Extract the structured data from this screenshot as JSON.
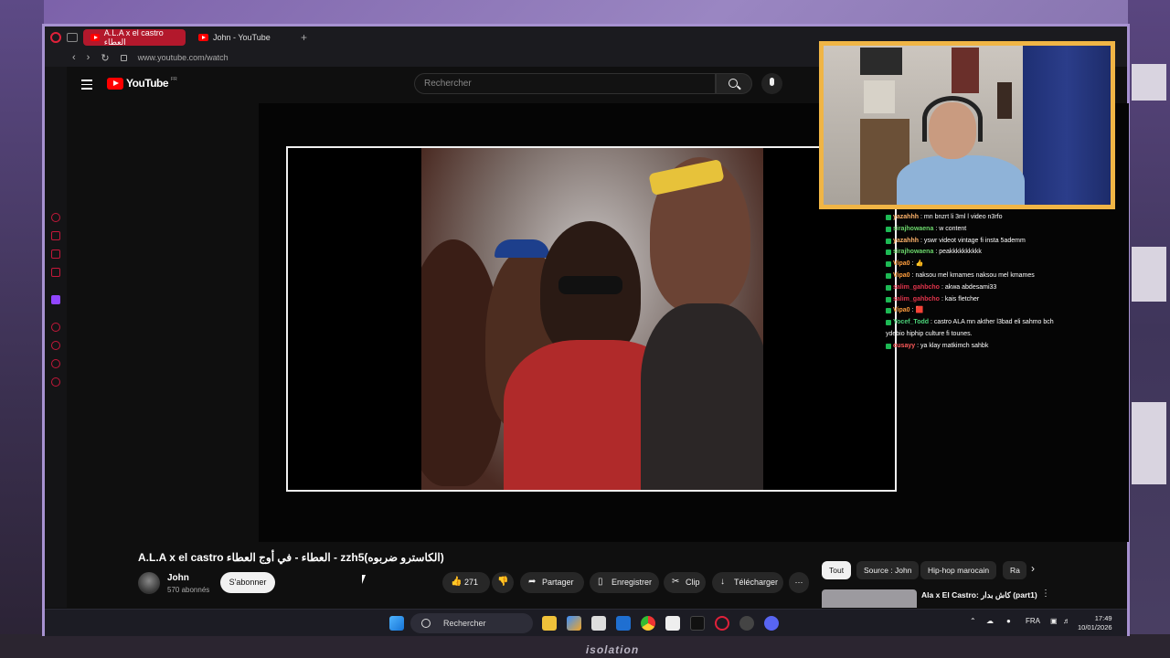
{
  "browser": {
    "tabs": [
      {
        "label": "A.L.A x el castro العطاء",
        "active": true
      },
      {
        "label": "John - YouTube",
        "active": false
      }
    ],
    "new_tab": "+",
    "url": "www.youtube.com/watch"
  },
  "youtube": {
    "logo": "YouTube",
    "logo_region": "FR",
    "search_placeholder": "Rechercher",
    "video_title": "A.L.A x el castro العطاء - في أوج العطاء - zzh5(الكاسترو ضربوه)",
    "channel": {
      "name": "John",
      "subscribers": "570 abonnés",
      "subscribe_label": "S'abonner"
    },
    "actions": {
      "likes": "271",
      "share": "Partager",
      "save": "Enregistrer",
      "clip": "Clip",
      "download": "Télécharger"
    },
    "chips": [
      "Tout",
      "Source : John",
      "Hip-hop marocain",
      "Ra"
    ],
    "next_video_title": "Ala x El Castro: كاش بدار (part1)"
  },
  "chat": [
    {
      "user": "yazahhh",
      "msg": ": mn bnzrt li 3ml l video n3rfo",
      "color": "#ffb36b"
    },
    {
      "user": "sirajhowaena",
      "msg": ": w content",
      "color": "#6bd66b"
    },
    {
      "user": "yazahhh",
      "msg": ": yswr videot vintage fi insta 5ademm",
      "color": "#ffb36b"
    },
    {
      "user": "sirajhowaena",
      "msg": ": peakkkkkkkkkk",
      "color": "#6bd66b"
    },
    {
      "user": "Vipa0",
      "msg": ": 👍",
      "color": "#ff9d3d"
    },
    {
      "user": "Vipa0",
      "msg": ": naksou mel kmames naksou mel kmames",
      "color": "#ff9d3d"
    },
    {
      "user": "salim_gahbcho",
      "msg": ": akwa abdesami33",
      "color": "#e0344b"
    },
    {
      "user": "salim_gahbcho",
      "msg": ": kais fletcher",
      "color": "#e0344b"
    },
    {
      "user": "Vipa0",
      "msg": ": 🟥",
      "color": "#ff9d3d"
    },
    {
      "user": "Yocef_Todd",
      "msg": ": castro ALA mn akther l3bad eli sahmo bch",
      "color": "#4bd37a"
    },
    {
      "user": "",
      "msg": "ydebio hiphip culture fi tounes.",
      "color": "#ffffff"
    },
    {
      "user": "ousayy",
      "msg": ": ya klay matkimch sahbk",
      "color": "#ff5a5a"
    }
  ],
  "taskbar": {
    "search": "Rechercher",
    "lang": "FRA",
    "time": "17:49",
    "date": "10/01/2026"
  },
  "stream_overlay": {
    "bottom_logo": "isolation"
  },
  "colors": {
    "accent": "#b3182c",
    "youtube_red": "#ff0000",
    "webcam_border": "#f0b545",
    "window_border": "#a792d1"
  }
}
